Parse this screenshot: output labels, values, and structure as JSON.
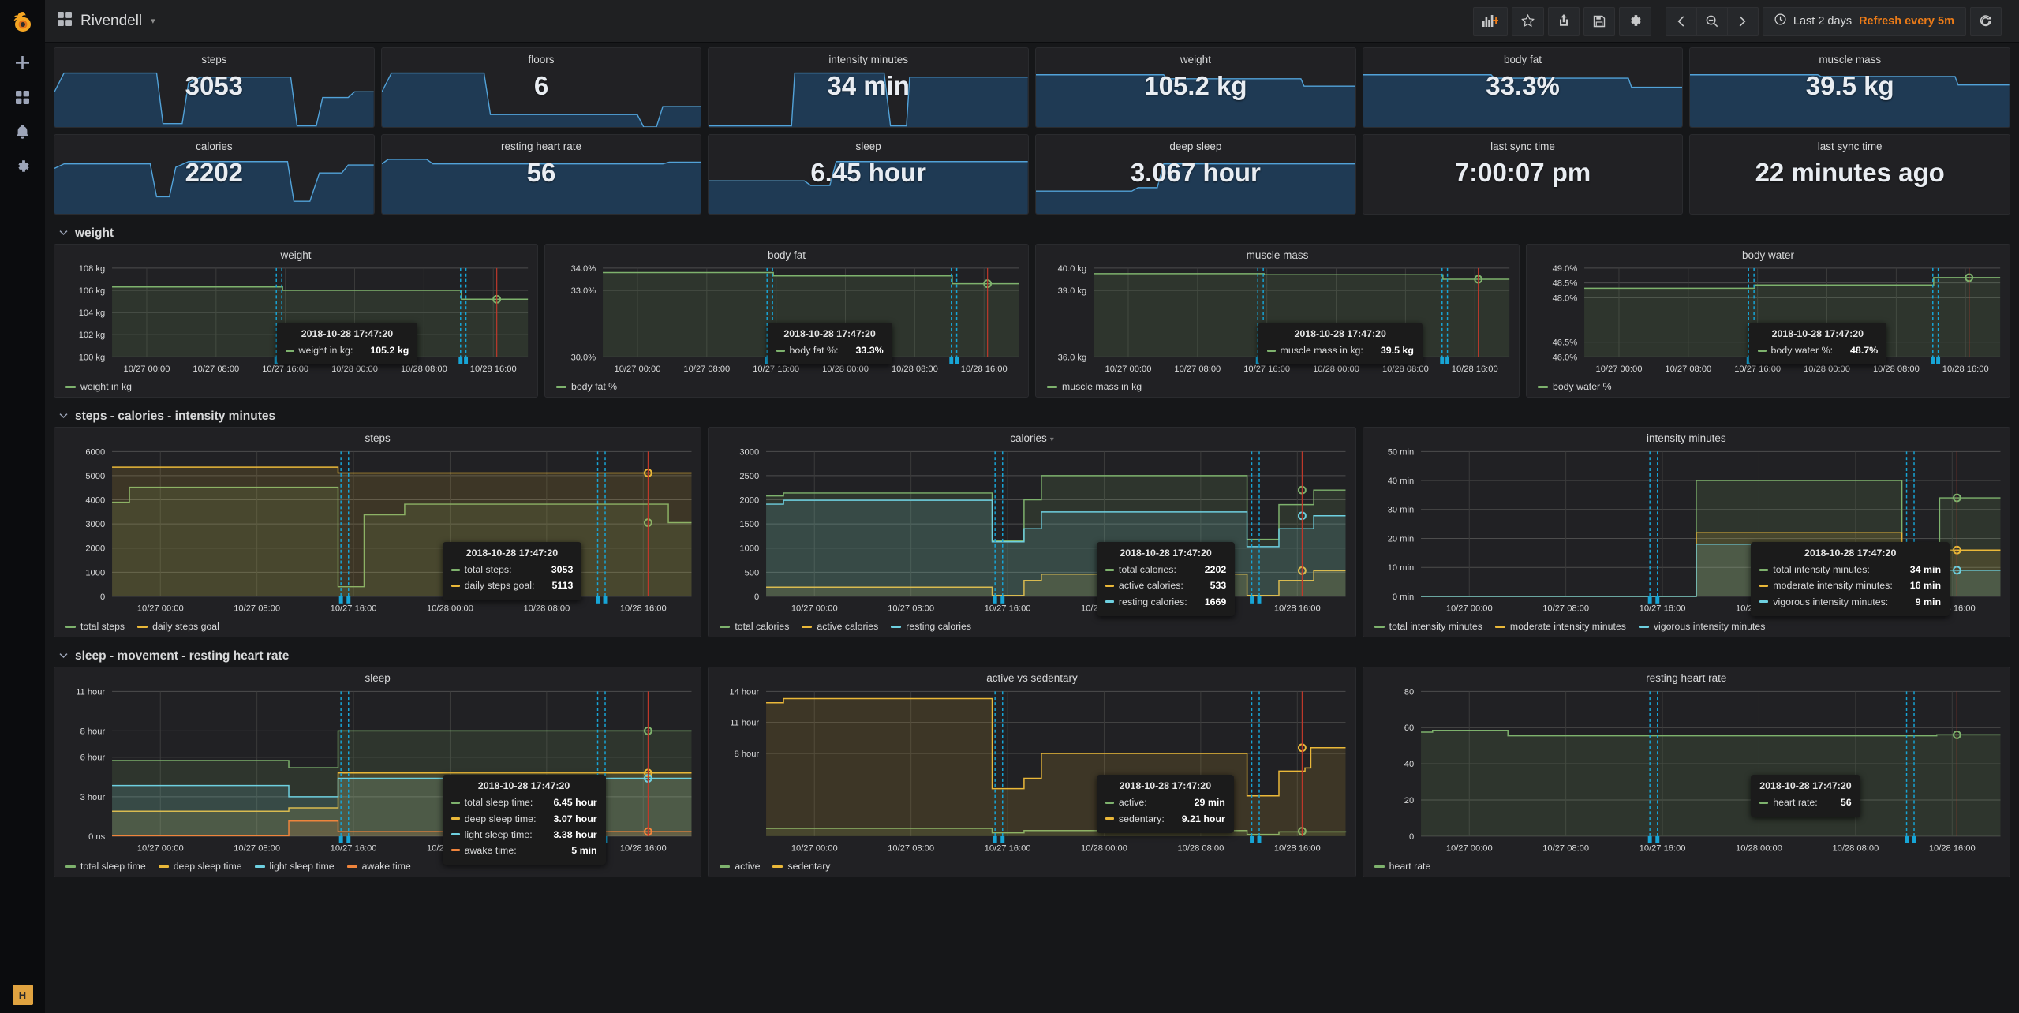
{
  "sidebar": {
    "logo_icon": "grafana-logo-icon",
    "items": [
      {
        "icon": "plus-icon",
        "name": "create"
      },
      {
        "icon": "dashboards-grid-icon",
        "name": "dashboards"
      },
      {
        "icon": "bell-icon",
        "name": "alerting"
      },
      {
        "icon": "gear-icon",
        "name": "configuration"
      }
    ],
    "avatar_initial": "H"
  },
  "topnav": {
    "apps_icon": "dashboard-grid-icon",
    "title": "Rivendell",
    "caret": "▾",
    "buttons": [
      {
        "name": "add-panel-button",
        "icon": "add-panel-icon"
      },
      {
        "name": "star-button",
        "icon": "star-icon"
      },
      {
        "name": "share-button",
        "icon": "share-icon"
      },
      {
        "name": "save-button",
        "icon": "save-icon"
      },
      {
        "name": "settings-button",
        "icon": "gear-icon"
      }
    ],
    "timenav": [
      {
        "name": "time-back-button",
        "icon": "chevron-left-icon"
      },
      {
        "name": "zoom-out-button",
        "icon": "zoom-out-icon"
      },
      {
        "name": "time-forward-button",
        "icon": "chevron-right-icon"
      }
    ],
    "time_range": "Last 2 days",
    "refresh_interval": "Refresh every 5m",
    "clock_icon": "clock-icon",
    "refresh_icon": "refresh-icon"
  },
  "stats": {
    "row1": [
      {
        "title": "steps",
        "value": "3053"
      },
      {
        "title": "floors",
        "value": "6"
      },
      {
        "title": "intensity minutes",
        "value": "34 min"
      },
      {
        "title": "weight",
        "value": "105.2 kg"
      },
      {
        "title": "body fat",
        "value": "33.3%"
      },
      {
        "title": "muscle mass",
        "value": "39.5 kg"
      }
    ],
    "row2": [
      {
        "title": "calories",
        "value": "2202"
      },
      {
        "title": "resting heart rate",
        "value": "56"
      },
      {
        "title": "sleep",
        "value": "6.45 hour"
      },
      {
        "title": "deep sleep",
        "value": "3.067 hour"
      },
      {
        "title": "last sync time",
        "value": "7:00:07 pm"
      },
      {
        "title": "last sync time",
        "value": "22 minutes ago"
      }
    ]
  },
  "sections": [
    {
      "title": "weight",
      "chevron": "⌄"
    },
    {
      "title": "steps - calories - intensity minutes",
      "chevron": "⌄"
    },
    {
      "title": "sleep - movement - resting heart rate",
      "chevron": "⌄"
    }
  ],
  "tooltip_time": "2018-10-28 17:47:20",
  "x_ticks": [
    "10/27 00:00",
    "10/27 08:00",
    "10/27 16:00",
    "10/28 00:00",
    "10/28 08:00",
    "10/28 16:00"
  ],
  "colors": {
    "green": "#7eb26d",
    "yellow": "#eab839",
    "cyan": "#6ed0e0",
    "orange": "#ef843c",
    "accent": "#eb7b18",
    "annotation": "#17a5d6",
    "crosshair": "#c0392b"
  },
  "chart_data": [
    {
      "id": "weight",
      "type": "line",
      "title": "weight",
      "ylabel": "",
      "ytick_labels": [
        "100 kg",
        "102 kg",
        "104 kg",
        "106 kg",
        "108 kg"
      ],
      "ytick_values": [
        100,
        102,
        104,
        106,
        108
      ],
      "ylim": [
        100,
        108
      ],
      "xlabel": "",
      "grid": true,
      "legend_position": "bottom",
      "series": [
        {
          "name": "weight in kg",
          "color": "#7eb26d",
          "x": [
            0,
            0.4,
            0.41,
            0.83,
            0.84,
            1.0
          ],
          "values": [
            106.3,
            106.3,
            106.0,
            106.0,
            105.2,
            105.2
          ]
        }
      ],
      "tooltip": {
        "time": "2018-10-28 17:47:20",
        "rows": [
          {
            "label": "weight in kg",
            "value": "105.2 kg",
            "color": "#7eb26d"
          }
        ]
      }
    },
    {
      "id": "body-fat",
      "type": "line",
      "title": "body fat",
      "ytick_labels": [
        "30.0%",
        "33.0%",
        "34.0%"
      ],
      "ytick_values": [
        30.0,
        33.0,
        34.0
      ],
      "ylim": [
        30.0,
        34.0
      ],
      "grid": true,
      "legend_position": "bottom",
      "series": [
        {
          "name": "body fat %",
          "color": "#7eb26d",
          "x": [
            0,
            0.4,
            0.41,
            0.83,
            0.84,
            1.0
          ],
          "values": [
            33.8,
            33.8,
            33.65,
            33.65,
            33.3,
            33.3
          ]
        }
      ],
      "tooltip": {
        "time": "2018-10-28 17:47:20",
        "rows": [
          {
            "label": "body fat %",
            "value": "33.3%",
            "color": "#7eb26d"
          }
        ]
      }
    },
    {
      "id": "muscle-mass",
      "type": "line",
      "title": "muscle mass",
      "ytick_labels": [
        "36.0 kg",
        "39.0 kg",
        "40.0 kg"
      ],
      "ytick_values": [
        36.0,
        39.0,
        40.0
      ],
      "ylim": [
        36.0,
        40.0
      ],
      "grid": true,
      "legend_position": "bottom",
      "series": [
        {
          "name": "muscle mass in kg",
          "color": "#7eb26d",
          "x": [
            0,
            0.4,
            0.41,
            0.83,
            0.84,
            1.0
          ],
          "values": [
            39.75,
            39.75,
            39.7,
            39.7,
            39.5,
            39.5
          ]
        }
      ],
      "tooltip": {
        "time": "2018-10-28 17:47:20",
        "rows": [
          {
            "label": "muscle mass in kg",
            "value": "39.5 kg",
            "color": "#7eb26d"
          }
        ]
      }
    },
    {
      "id": "body-water",
      "type": "line",
      "title": "body water",
      "ytick_labels": [
        "46.0%",
        "46.5%",
        "48.0%",
        "48.5%",
        "49.0%"
      ],
      "ytick_values": [
        46.0,
        46.5,
        48.0,
        48.5,
        49.0
      ],
      "ylim": [
        46.0,
        49.0
      ],
      "grid": true,
      "legend_position": "bottom",
      "series": [
        {
          "name": "body water %",
          "color": "#7eb26d",
          "x": [
            0,
            0.4,
            0.41,
            0.83,
            0.84,
            1.0
          ],
          "values": [
            48.32,
            48.32,
            48.43,
            48.43,
            48.68,
            48.68
          ]
        }
      ],
      "tooltip": {
        "time": "2018-10-28 17:47:20",
        "rows": [
          {
            "label": "body water %",
            "value": "48.7%",
            "color": "#7eb26d"
          }
        ]
      }
    },
    {
      "id": "steps",
      "type": "line",
      "title": "steps",
      "ytick_labels": [
        "0",
        "1000",
        "2000",
        "3000",
        "4000",
        "5000",
        "6000"
      ],
      "ytick_values": [
        0,
        1000,
        2000,
        3000,
        4000,
        5000,
        6000
      ],
      "ylim": [
        0,
        6000
      ],
      "grid": true,
      "legend_position": "bottom",
      "series": [
        {
          "name": "total steps",
          "color": "#7eb26d",
          "x": [
            0,
            0.02,
            0.03,
            0.385,
            0.39,
            0.43,
            0.435,
            0.5,
            0.505,
            0.95,
            0.96,
            1.0
          ],
          "values": [
            3900,
            3900,
            4520,
            4520,
            400,
            400,
            3380,
            3380,
            3820,
            3820,
            3053,
            3053
          ]
        },
        {
          "name": "daily steps goal",
          "color": "#eab839",
          "x": [
            0,
            0.385,
            0.39,
            1.0
          ],
          "values": [
            5350,
            5350,
            5113,
            5113
          ]
        }
      ],
      "tooltip": {
        "time": "2018-10-28 17:47:20",
        "rows": [
          {
            "label": "total steps",
            "value": "3053",
            "color": "#7eb26d"
          },
          {
            "label": "daily steps goal",
            "value": "5113",
            "color": "#eab839"
          }
        ]
      }
    },
    {
      "id": "calories",
      "type": "line",
      "title": "calories",
      "has_caret": true,
      "ytick_labels": [
        "0",
        "500",
        "1000",
        "1500",
        "2000",
        "2500",
        "3000"
      ],
      "ytick_values": [
        0,
        500,
        1000,
        1500,
        2000,
        2500,
        3000
      ],
      "ylim": [
        0,
        3000
      ],
      "grid": true,
      "legend_position": "bottom",
      "series": [
        {
          "name": "total calories",
          "color": "#7eb26d",
          "x": [
            0,
            0.02,
            0.03,
            0.38,
            0.39,
            0.44,
            0.445,
            0.47,
            0.475,
            0.82,
            0.83,
            0.88,
            0.885,
            0.94,
            0.945,
            1.0
          ],
          "values": [
            2080,
            2080,
            2140,
            2140,
            1150,
            1150,
            2000,
            2000,
            2500,
            2500,
            1180,
            1180,
            1900,
            1900,
            2202,
            2202
          ]
        },
        {
          "name": "active calories",
          "color": "#eab839",
          "x": [
            0,
            0.38,
            0.39,
            0.44,
            0.445,
            0.47,
            0.475,
            0.82,
            0.83,
            0.88,
            0.885,
            0.94,
            0.945,
            1.0
          ],
          "values": [
            190,
            190,
            20,
            20,
            330,
            330,
            460,
            460,
            20,
            20,
            330,
            330,
            533,
            533
          ]
        },
        {
          "name": "resting calories",
          "color": "#6ed0e0",
          "x": [
            0,
            0.02,
            0.03,
            0.38,
            0.39,
            0.44,
            0.445,
            0.47,
            0.475,
            0.82,
            0.83,
            0.88,
            0.885,
            0.94,
            0.945,
            1.0
          ],
          "values": [
            1910,
            1910,
            1990,
            1990,
            1130,
            1130,
            1400,
            1400,
            1750,
            1750,
            1030,
            1030,
            1400,
            1400,
            1669,
            1669
          ]
        }
      ],
      "tooltip": {
        "time": "2018-10-28 17:47:20",
        "rows": [
          {
            "label": "total calories",
            "value": "2202",
            "color": "#7eb26d"
          },
          {
            "label": "active calories",
            "value": "533",
            "color": "#eab839"
          },
          {
            "label": "resting calories",
            "value": "1669",
            "color": "#6ed0e0"
          }
        ]
      }
    },
    {
      "id": "intensity-minutes",
      "type": "line",
      "title": "intensity minutes",
      "ytick_labels": [
        "0 min",
        "10 min",
        "20 min",
        "30 min",
        "40 min",
        "50 min"
      ],
      "ytick_values": [
        0,
        10,
        20,
        30,
        40,
        50
      ],
      "ylim": [
        0,
        50
      ],
      "grid": true,
      "legend_position": "bottom",
      "series": [
        {
          "name": "total intensity minutes",
          "color": "#7eb26d",
          "x": [
            0,
            0.47,
            0.475,
            0.82,
            0.83,
            0.89,
            0.895,
            1.0
          ],
          "values": [
            0,
            0,
            40,
            40,
            0,
            0,
            34,
            34
          ]
        },
        {
          "name": "moderate intensity minutes",
          "color": "#eab839",
          "x": [
            0,
            0.47,
            0.475,
            0.82,
            0.83,
            0.89,
            0.895,
            1.0
          ],
          "values": [
            0,
            0,
            22,
            22,
            0,
            0,
            16,
            16
          ]
        },
        {
          "name": "vigorous intensity minutes",
          "color": "#6ed0e0",
          "x": [
            0,
            0.47,
            0.475,
            0.82,
            0.83,
            0.89,
            0.895,
            1.0
          ],
          "values": [
            0,
            0,
            18,
            18,
            0,
            0,
            9,
            9
          ]
        }
      ],
      "tooltip": {
        "time": "2018-10-28 17:47:20",
        "rows": [
          {
            "label": "total intensity minutes",
            "value": "34 min",
            "color": "#7eb26d"
          },
          {
            "label": "moderate intensity minutes",
            "value": "16 min",
            "color": "#eab839"
          },
          {
            "label": "vigorous intensity minutes",
            "value": "9 min",
            "color": "#6ed0e0"
          }
        ]
      }
    },
    {
      "id": "sleep",
      "type": "line",
      "title": "sleep",
      "ytick_labels": [
        "0 ns",
        "3 hour",
        "6 hour",
        "8 hour",
        "11 hour"
      ],
      "ytick_values": [
        0,
        3,
        6,
        8,
        11
      ],
      "ylim": [
        0,
        11
      ],
      "grid": true,
      "legend_position": "bottom",
      "series": [
        {
          "name": "total sleep time",
          "color": "#7eb26d",
          "x": [
            0,
            0.3,
            0.305,
            0.385,
            0.39,
            1.0
          ],
          "values": [
            5.75,
            5.75,
            5.2,
            5.2,
            8.0,
            8.0
          ]
        },
        {
          "name": "deep sleep time",
          "color": "#eab839",
          "x": [
            0,
            0.3,
            0.305,
            0.385,
            0.39,
            1.0
          ],
          "values": [
            1.9,
            1.9,
            2.15,
            2.15,
            4.8,
            4.8
          ]
        },
        {
          "name": "light sleep time",
          "color": "#6ed0e0",
          "x": [
            0,
            0.3,
            0.305,
            0.385,
            0.39,
            1.0
          ],
          "values": [
            3.85,
            3.85,
            3.0,
            3.0,
            4.4,
            4.4
          ]
        },
        {
          "name": "awake time",
          "color": "#ef843c",
          "x": [
            0,
            0.3,
            0.305,
            0.385,
            0.39,
            1.0
          ],
          "values": [
            0.03,
            0.03,
            1.15,
            1.15,
            0.35,
            0.35
          ]
        }
      ],
      "tooltip": {
        "time": "2018-10-28 17:47:20",
        "rows": [
          {
            "label": "total sleep time",
            "value": "6.45 hour",
            "color": "#7eb26d"
          },
          {
            "label": "deep sleep time",
            "value": "3.07 hour",
            "color": "#eab839"
          },
          {
            "label": "light sleep time",
            "value": "3.38 hour",
            "color": "#6ed0e0"
          },
          {
            "label": "awake time",
            "value": "5 min",
            "color": "#ef843c"
          }
        ]
      }
    },
    {
      "id": "active-vs-sedentary",
      "type": "line",
      "title": "active vs sedentary",
      "ytick_labels": [
        "8 hour",
        "11 hour",
        "14 hour"
      ],
      "ytick_values": [
        8,
        11,
        14
      ],
      "ylim": [
        0,
        14
      ],
      "grid": true,
      "legend_position": "bottom",
      "series": [
        {
          "name": "active",
          "color": "#7eb26d",
          "x": [
            0,
            0.38,
            0.39,
            0.44,
            0.445,
            0.82,
            0.83,
            0.88,
            0.885,
            1.0
          ],
          "values": [
            0.75,
            0.75,
            0.33,
            0.33,
            0.55,
            0.55,
            0.18,
            0.18,
            0.42,
            0.48
          ]
        },
        {
          "name": "sedentary",
          "color": "#eab839",
          "x": [
            0,
            0.02,
            0.03,
            0.38,
            0.39,
            0.44,
            0.445,
            0.47,
            0.475,
            0.82,
            0.83,
            0.88,
            0.885,
            0.93,
            0.94,
            1.0
          ],
          "values": [
            12.9,
            12.9,
            13.3,
            13.3,
            4.6,
            4.6,
            5.6,
            5.6,
            8.0,
            8.0,
            3.9,
            3.9,
            6.3,
            6.6,
            8.55,
            8.55
          ]
        }
      ],
      "tooltip": {
        "time": "2018-10-28 17:47:20",
        "rows": [
          {
            "label": "active",
            "value": "29 min",
            "color": "#7eb26d"
          },
          {
            "label": "sedentary",
            "value": "9.21 hour",
            "color": "#eab839"
          }
        ]
      }
    },
    {
      "id": "resting-heart-rate",
      "type": "line",
      "title": "resting heart rate",
      "ytick_labels": [
        "0",
        "20",
        "40",
        "60",
        "80"
      ],
      "ytick_values": [
        0,
        20,
        40,
        60,
        80
      ],
      "ylim": [
        0,
        80
      ],
      "grid": true,
      "legend_position": "bottom",
      "series": [
        {
          "name": "heart rate",
          "color": "#7eb26d",
          "x": [
            0,
            0.01,
            0.02,
            0.14,
            0.15,
            0.88,
            0.89,
            1.0
          ],
          "values": [
            57.5,
            57.5,
            58.5,
            58.5,
            55.5,
            55.5,
            56,
            56
          ]
        }
      ],
      "tooltip": {
        "time": "2018-10-28 17:47:20",
        "rows": [
          {
            "label": "heart rate",
            "value": "56",
            "color": "#7eb26d"
          }
        ]
      }
    }
  ]
}
